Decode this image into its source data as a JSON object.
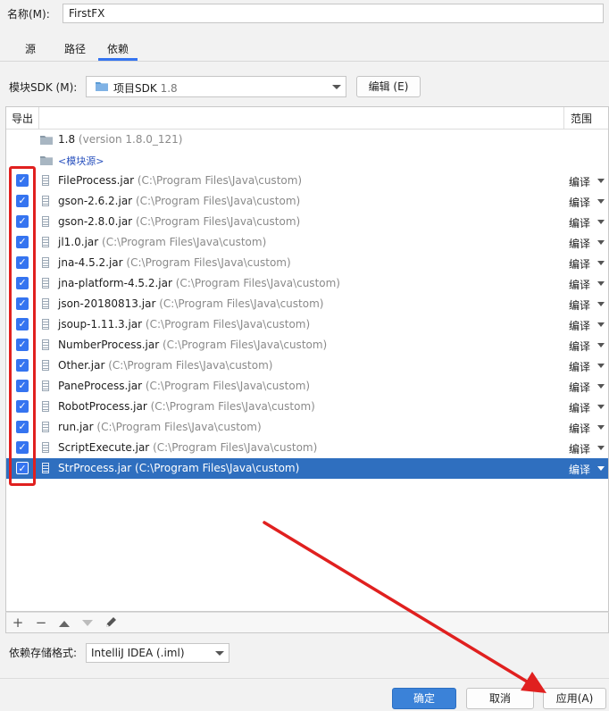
{
  "name_row": {
    "label": "名称(M):",
    "value": "FirstFX"
  },
  "tabs": [
    {
      "label": "源",
      "active": false
    },
    {
      "label": "路径",
      "active": false
    },
    {
      "label": "依赖",
      "active": true
    }
  ],
  "sdk": {
    "label": "模块SDK (M):",
    "selected": "项目SDK",
    "selected_version": "1.8",
    "edit_button": "编辑 (E)"
  },
  "table": {
    "col_export": "导出",
    "col_scope": "范围",
    "sdk_entry": {
      "name": "1.8",
      "detail": "(version 1.8.0_121)"
    },
    "module_source": "<模块源>",
    "rows": [
      {
        "name": "FileProcess.jar",
        "path": "(C:\\Program Files\\Java\\custom)",
        "scope": "编译",
        "checked": true
      },
      {
        "name": "gson-2.6.2.jar",
        "path": "(C:\\Program Files\\Java\\custom)",
        "scope": "编译",
        "checked": true
      },
      {
        "name": "gson-2.8.0.jar",
        "path": "(C:\\Program Files\\Java\\custom)",
        "scope": "编译",
        "checked": true
      },
      {
        "name": "jl1.0.jar",
        "path": "(C:\\Program Files\\Java\\custom)",
        "scope": "编译",
        "checked": true
      },
      {
        "name": "jna-4.5.2.jar",
        "path": "(C:\\Program Files\\Java\\custom)",
        "scope": "编译",
        "checked": true
      },
      {
        "name": "jna-platform-4.5.2.jar",
        "path": "(C:\\Program Files\\Java\\custom)",
        "scope": "编译",
        "checked": true
      },
      {
        "name": "json-20180813.jar",
        "path": "(C:\\Program Files\\Java\\custom)",
        "scope": "编译",
        "checked": true
      },
      {
        "name": "jsoup-1.11.3.jar",
        "path": "(C:\\Program Files\\Java\\custom)",
        "scope": "编译",
        "checked": true
      },
      {
        "name": "NumberProcess.jar",
        "path": "(C:\\Program Files\\Java\\custom)",
        "scope": "编译",
        "checked": true
      },
      {
        "name": "Other.jar",
        "path": "(C:\\Program Files\\Java\\custom)",
        "scope": "编译",
        "checked": true
      },
      {
        "name": "PaneProcess.jar",
        "path": "(C:\\Program Files\\Java\\custom)",
        "scope": "编译",
        "checked": true
      },
      {
        "name": "RobotProcess.jar",
        "path": "(C:\\Program Files\\Java\\custom)",
        "scope": "编译",
        "checked": true
      },
      {
        "name": "run.jar",
        "path": "(C:\\Program Files\\Java\\custom)",
        "scope": "编译",
        "checked": true
      },
      {
        "name": "ScriptExecute.jar",
        "path": "(C:\\Program Files\\Java\\custom)",
        "scope": "编译",
        "checked": true
      },
      {
        "name": "StrProcess.jar",
        "path": "(C:\\Program Files\\Java\\custom)",
        "scope": "编译",
        "checked": true,
        "selected": true
      }
    ]
  },
  "toolbar": {
    "icons": [
      "plus-icon",
      "minus-icon",
      "move-up-icon",
      "move-down-icon",
      "edit-pencil-icon"
    ]
  },
  "storage": {
    "label": "依赖存储格式:",
    "selected": "IntelliJ IDEA (.iml)"
  },
  "buttons": {
    "ok": "确定",
    "cancel": "取消",
    "apply": "应用(A)"
  },
  "colors": {
    "accent": "#3574f0",
    "selection": "#2f6fbf",
    "annotation_red": "#e0201f"
  }
}
